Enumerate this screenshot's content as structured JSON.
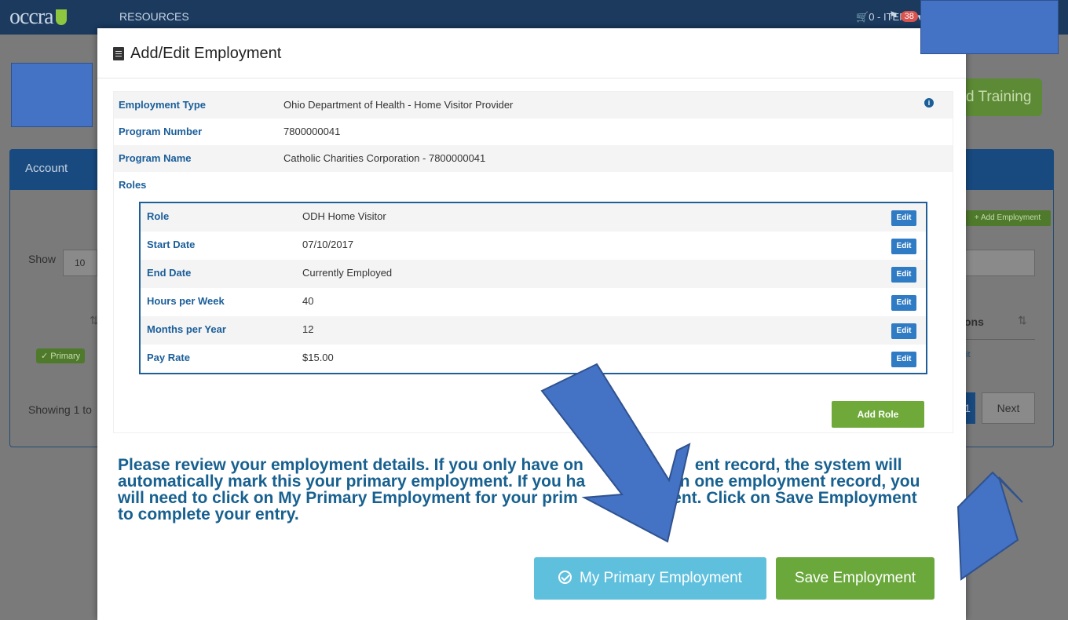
{
  "app": {
    "logo_text": "occra",
    "nav_resources": "RESOURCES",
    "cart_label": "0 - ITEMS",
    "flag_count": "38"
  },
  "background": {
    "training_button": "d Training",
    "account_tab": "Account",
    "add_employment": "Add Employment",
    "show_label": "Show",
    "show_value": "10",
    "primary_badge": "Primary",
    "showing_text": "Showing 1 to",
    "actions_header": "ons",
    "edit_link": "it",
    "page_number": "1",
    "next_label": "Next"
  },
  "modal": {
    "title": "Add/Edit Employment",
    "details": [
      {
        "label": "Employment Type",
        "value": "Ohio Department of Health - Home Visitor Provider"
      },
      {
        "label": "Program Number",
        "value": "7800000041"
      },
      {
        "label": "Program Name",
        "value": "Catholic Charities Corporation - 7800000041"
      },
      {
        "label": "Roles",
        "value": ""
      }
    ],
    "roles": [
      {
        "label": "Role",
        "value": "ODH Home Visitor",
        "action": "Edit"
      },
      {
        "label": "Start Date",
        "value": "07/10/2017",
        "action": "Edit"
      },
      {
        "label": "End Date",
        "value": "Currently Employed",
        "action": "Edit"
      },
      {
        "label": "Hours per Week",
        "value": "40",
        "action": "Edit"
      },
      {
        "label": "Months per Year",
        "value": "12",
        "action": "Edit"
      },
      {
        "label": "Pay Rate",
        "value": "$15.00",
        "action": "Edit"
      }
    ],
    "add_role_label": "Add Role",
    "instructions": [
      "Please review your employment details. If you only have on",
      "ent record, the system will",
      "automatically mark this your primary employment. If you ha",
      "han one employment record, you",
      "will need to click on My Primary Employment for your prim",
      "yment. Click on Save Employment",
      "to complete your entry."
    ],
    "primary_button_label": "My Primary Employment",
    "save_button_label": "Save Employment"
  },
  "icons": {
    "title_icon": "building-icon",
    "info_icon": "info-circle-icon",
    "check_icon": "check-circle-icon"
  },
  "colors": {
    "label_blue": "#1a5e9a",
    "instruction_blue": "#17608f",
    "edit_blue": "#2f7bc4",
    "green": "#6aa83b",
    "info_button": "#5fc0de",
    "annotation_blue": "#4472c4"
  }
}
